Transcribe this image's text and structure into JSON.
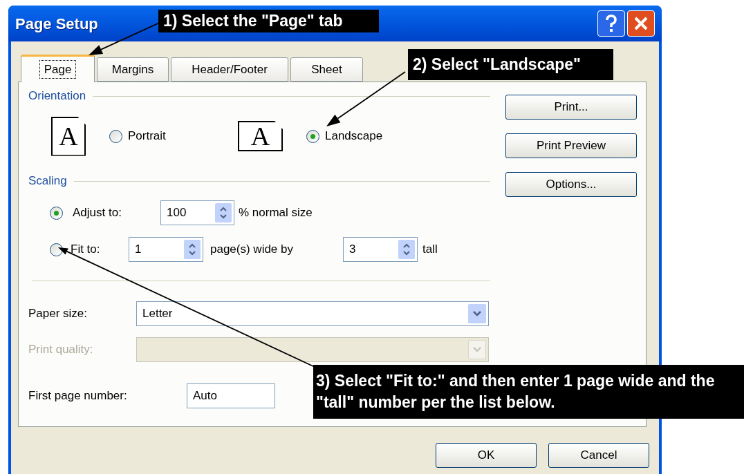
{
  "window": {
    "title": "Page Setup"
  },
  "tabs": [
    {
      "label": "Page",
      "selected": true
    },
    {
      "label": "Margins",
      "selected": false
    },
    {
      "label": "Header/Footer",
      "selected": false
    },
    {
      "label": "Sheet",
      "selected": false
    }
  ],
  "orientation": {
    "label": "Orientation",
    "options": [
      {
        "kind": "portrait",
        "icon_text": "A",
        "label": "Portrait",
        "selected": false
      },
      {
        "kind": "landscape",
        "icon_text": "A",
        "label": "Landscape",
        "selected": true
      }
    ]
  },
  "scaling": {
    "label": "Scaling",
    "adjust": {
      "label": "Adjust to:",
      "selected": true,
      "value": "100",
      "suffix": "% normal size"
    },
    "fit": {
      "label": "Fit to:",
      "selected": false,
      "wide_value": "1",
      "wide_suffix": "page(s) wide by",
      "tall_value": "3",
      "tall_suffix": "tall"
    }
  },
  "paper_size": {
    "label": "Paper size:",
    "value": "Letter",
    "disabled": false
  },
  "print_quality": {
    "label": "Print quality:",
    "disabled": true
  },
  "first_page_number": {
    "label": "First page number:",
    "value": "Auto"
  },
  "side_buttons": [
    "Print...",
    "Print Preview",
    "Options..."
  ],
  "footer_buttons": [
    "OK",
    "Cancel"
  ],
  "annotations": [
    {
      "text": "1) Select the \"Page\" tab"
    },
    {
      "text": "2) Select \"Landscape\""
    },
    {
      "text": "3) Select \"Fit to:\" and then enter 1 page wide and the \"tall\" number per the list below."
    }
  ]
}
